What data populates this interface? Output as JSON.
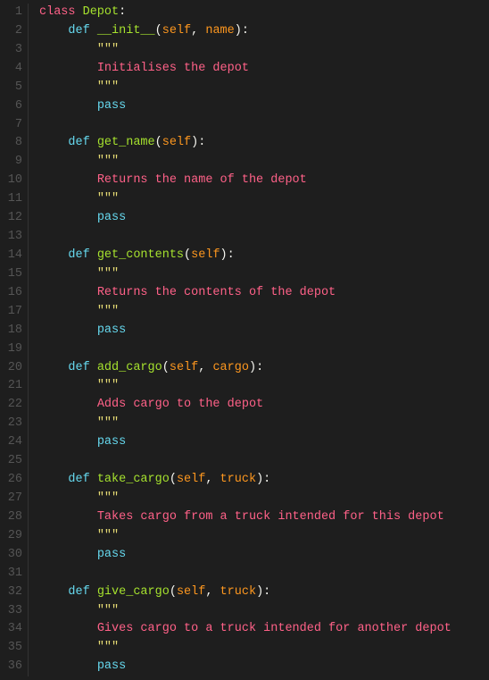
{
  "lines": [
    {
      "num": 1,
      "tokens": [
        {
          "t": "kw-class",
          "v": "class "
        },
        {
          "t": "class-name",
          "v": "Depot"
        },
        {
          "t": "punct",
          "v": ":"
        }
      ]
    },
    {
      "num": 2,
      "tokens": [
        {
          "t": "plain",
          "v": "    "
        },
        {
          "t": "kw-def",
          "v": "def "
        },
        {
          "t": "fn-name",
          "v": "__init__"
        },
        {
          "t": "punct",
          "v": "("
        },
        {
          "t": "param",
          "v": "self"
        },
        {
          "t": "punct",
          "v": ", "
        },
        {
          "t": "param",
          "v": "name"
        },
        {
          "t": "punct",
          "v": "):"
        }
      ]
    },
    {
      "num": 3,
      "tokens": [
        {
          "t": "plain",
          "v": "        "
        },
        {
          "t": "docstring",
          "v": "\"\"\""
        }
      ]
    },
    {
      "num": 4,
      "tokens": [
        {
          "t": "plain",
          "v": "        "
        },
        {
          "t": "comment-text",
          "v": "Initialises the depot"
        }
      ]
    },
    {
      "num": 5,
      "tokens": [
        {
          "t": "plain",
          "v": "        "
        },
        {
          "t": "docstring",
          "v": "\"\"\""
        }
      ]
    },
    {
      "num": 6,
      "tokens": [
        {
          "t": "plain",
          "v": "        "
        },
        {
          "t": "kw-pass",
          "v": "pass"
        }
      ]
    },
    {
      "num": 7,
      "tokens": []
    },
    {
      "num": 8,
      "tokens": [
        {
          "t": "plain",
          "v": "    "
        },
        {
          "t": "kw-def",
          "v": "def "
        },
        {
          "t": "fn-name",
          "v": "get_name"
        },
        {
          "t": "punct",
          "v": "("
        },
        {
          "t": "param",
          "v": "self"
        },
        {
          "t": "punct",
          "v": "):"
        }
      ]
    },
    {
      "num": 9,
      "tokens": [
        {
          "t": "plain",
          "v": "        "
        },
        {
          "t": "docstring",
          "v": "\"\"\""
        }
      ]
    },
    {
      "num": 10,
      "tokens": [
        {
          "t": "plain",
          "v": "        "
        },
        {
          "t": "comment-text",
          "v": "Returns the name of the depot"
        }
      ]
    },
    {
      "num": 11,
      "tokens": [
        {
          "t": "plain",
          "v": "        "
        },
        {
          "t": "docstring",
          "v": "\"\"\""
        }
      ]
    },
    {
      "num": 12,
      "tokens": [
        {
          "t": "plain",
          "v": "        "
        },
        {
          "t": "kw-pass",
          "v": "pass"
        }
      ]
    },
    {
      "num": 13,
      "tokens": []
    },
    {
      "num": 14,
      "tokens": [
        {
          "t": "plain",
          "v": "    "
        },
        {
          "t": "kw-def",
          "v": "def "
        },
        {
          "t": "fn-name",
          "v": "get_contents"
        },
        {
          "t": "punct",
          "v": "("
        },
        {
          "t": "param",
          "v": "self"
        },
        {
          "t": "punct",
          "v": "):"
        }
      ]
    },
    {
      "num": 15,
      "tokens": [
        {
          "t": "plain",
          "v": "        "
        },
        {
          "t": "docstring",
          "v": "\"\"\""
        }
      ]
    },
    {
      "num": 16,
      "tokens": [
        {
          "t": "plain",
          "v": "        "
        },
        {
          "t": "comment-text",
          "v": "Returns the contents of the depot"
        }
      ]
    },
    {
      "num": 17,
      "tokens": [
        {
          "t": "plain",
          "v": "        "
        },
        {
          "t": "docstring",
          "v": "\"\"\""
        }
      ]
    },
    {
      "num": 18,
      "tokens": [
        {
          "t": "plain",
          "v": "        "
        },
        {
          "t": "kw-pass",
          "v": "pass"
        }
      ]
    },
    {
      "num": 19,
      "tokens": []
    },
    {
      "num": 20,
      "tokens": [
        {
          "t": "plain",
          "v": "    "
        },
        {
          "t": "kw-def",
          "v": "def "
        },
        {
          "t": "fn-name",
          "v": "add_cargo"
        },
        {
          "t": "punct",
          "v": "("
        },
        {
          "t": "param",
          "v": "self"
        },
        {
          "t": "punct",
          "v": ", "
        },
        {
          "t": "param",
          "v": "cargo"
        },
        {
          "t": "punct",
          "v": "):"
        }
      ]
    },
    {
      "num": 21,
      "tokens": [
        {
          "t": "plain",
          "v": "        "
        },
        {
          "t": "docstring",
          "v": "\"\"\""
        }
      ]
    },
    {
      "num": 22,
      "tokens": [
        {
          "t": "plain",
          "v": "        "
        },
        {
          "t": "comment-text",
          "v": "Adds cargo to the depot"
        }
      ]
    },
    {
      "num": 23,
      "tokens": [
        {
          "t": "plain",
          "v": "        "
        },
        {
          "t": "docstring",
          "v": "\"\"\""
        }
      ]
    },
    {
      "num": 24,
      "tokens": [
        {
          "t": "plain",
          "v": "        "
        },
        {
          "t": "kw-pass",
          "v": "pass"
        }
      ]
    },
    {
      "num": 25,
      "tokens": []
    },
    {
      "num": 26,
      "tokens": [
        {
          "t": "plain",
          "v": "    "
        },
        {
          "t": "kw-def",
          "v": "def "
        },
        {
          "t": "fn-name",
          "v": "take_cargo"
        },
        {
          "t": "punct",
          "v": "("
        },
        {
          "t": "param",
          "v": "self"
        },
        {
          "t": "punct",
          "v": ", "
        },
        {
          "t": "param",
          "v": "truck"
        },
        {
          "t": "punct",
          "v": "):"
        }
      ]
    },
    {
      "num": 27,
      "tokens": [
        {
          "t": "plain",
          "v": "        "
        },
        {
          "t": "docstring",
          "v": "\"\"\""
        }
      ]
    },
    {
      "num": 28,
      "tokens": [
        {
          "t": "plain",
          "v": "        "
        },
        {
          "t": "comment-text",
          "v": "Takes cargo from a truck intended for this depot"
        }
      ]
    },
    {
      "num": 29,
      "tokens": [
        {
          "t": "plain",
          "v": "        "
        },
        {
          "t": "docstring",
          "v": "\"\"\""
        }
      ]
    },
    {
      "num": 30,
      "tokens": [
        {
          "t": "plain",
          "v": "        "
        },
        {
          "t": "kw-pass",
          "v": "pass"
        }
      ]
    },
    {
      "num": 31,
      "tokens": []
    },
    {
      "num": 32,
      "tokens": [
        {
          "t": "plain",
          "v": "    "
        },
        {
          "t": "kw-def",
          "v": "def "
        },
        {
          "t": "fn-name",
          "v": "give_cargo"
        },
        {
          "t": "punct",
          "v": "("
        },
        {
          "t": "param",
          "v": "self"
        },
        {
          "t": "punct",
          "v": ", "
        },
        {
          "t": "param",
          "v": "truck"
        },
        {
          "t": "punct",
          "v": "):"
        }
      ]
    },
    {
      "num": 33,
      "tokens": [
        {
          "t": "plain",
          "v": "        "
        },
        {
          "t": "docstring",
          "v": "\"\"\""
        }
      ]
    },
    {
      "num": 34,
      "tokens": [
        {
          "t": "plain",
          "v": "        "
        },
        {
          "t": "comment-text",
          "v": "Gives cargo to a truck intended for another depot"
        }
      ]
    },
    {
      "num": 35,
      "tokens": [
        {
          "t": "plain",
          "v": "        "
        },
        {
          "t": "docstring",
          "v": "\"\"\""
        }
      ]
    },
    {
      "num": 36,
      "tokens": [
        {
          "t": "plain",
          "v": "        "
        },
        {
          "t": "kw-pass",
          "v": "pass"
        }
      ]
    }
  ]
}
